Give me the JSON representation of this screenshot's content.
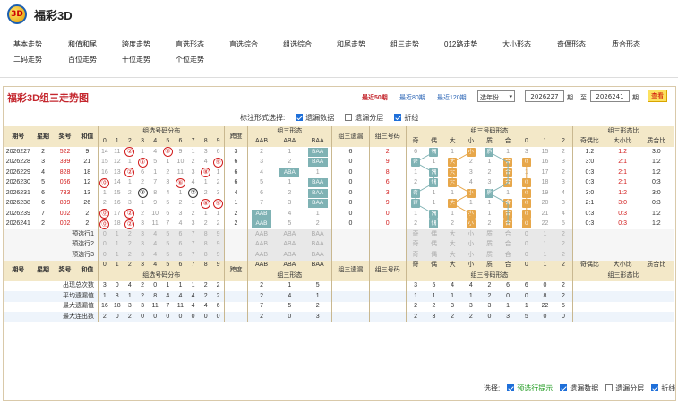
{
  "app": {
    "title": "福彩3D",
    "logo_text": "3D"
  },
  "nav": [
    "基本走势",
    "和值和尾",
    "跨度走势",
    "直选形态",
    "直选综合",
    "组选综合",
    "和尾走势",
    "组三走势",
    "012路走势",
    "大小形态",
    "奇偶形态",
    "质合形态",
    "二码走势",
    "百位走势",
    "十位走势",
    "个位走势"
  ],
  "panel": {
    "title": "福彩3D组三走势图",
    "quick": [
      "最近50期",
      "最近80期",
      "最近120期"
    ],
    "select": "选年份",
    "from": "2026227",
    "sep1": "期",
    "to_label": "至",
    "to": "2026241",
    "sep2": "期",
    "query": "查看"
  },
  "options": {
    "label": "标注形式选择:",
    "items": [
      {
        "text": "遗漏数据",
        "checked": true
      },
      {
        "text": "遗漏分层",
        "checked": false
      },
      {
        "text": "折线",
        "checked": true
      }
    ]
  },
  "headers": {
    "period": "期号",
    "week": "星期",
    "prize": "奖号",
    "sum": "和值",
    "dist": "组选号码分布",
    "span": "跨度",
    "shape": "组三形态",
    "miss": "组三遗漏",
    "code": "组三号码",
    "nshape": "组三号码形态",
    "ratio": "组三形态比",
    "digits": [
      "0",
      "1",
      "2",
      "3",
      "4",
      "5",
      "6",
      "7",
      "8",
      "9"
    ],
    "shapes": [
      "AAB",
      "ABA",
      "BAA"
    ],
    "nshapes": [
      "奇",
      "偶",
      "大",
      "小",
      "质",
      "合",
      "0",
      "1",
      "2"
    ],
    "ratios": [
      "奇偶比",
      "大小比",
      "质合比"
    ]
  },
  "rows": [
    {
      "period": "2026227",
      "week": "2",
      "prize": "522",
      "sum": "9",
      "dist": [
        "14",
        "11",
        "②",
        "1",
        "4",
        "⑤",
        "9",
        "1",
        "3",
        "6"
      ],
      "span": "3",
      "shape": [
        "2",
        "1",
        "BAA"
      ],
      "miss": "6",
      "code": "2",
      "nshape": [
        "6",
        "偶",
        "1",
        "小",
        "质",
        "1",
        "3",
        "15",
        "2"
      ],
      "ratio": [
        "1:2",
        "1:2",
        "3:0"
      ]
    },
    {
      "period": "2026228",
      "week": "3",
      "prize": "399",
      "sum": "21",
      "dist": [
        "15",
        "12",
        "1",
        "⑤",
        "5",
        "1",
        "10",
        "2",
        "4",
        "⑨"
      ],
      "span": "6",
      "shape": [
        "3",
        "2",
        "BAA"
      ],
      "miss": "0",
      "code": "9",
      "nshape": [
        "奇",
        "1",
        "大",
        "2",
        "1",
        "合",
        "0",
        "16",
        "3"
      ],
      "ratio": [
        "3:0",
        "2:1",
        "1:2"
      ]
    },
    {
      "period": "2026229",
      "week": "4",
      "prize": "828",
      "sum": "18",
      "dist": [
        "16",
        "13",
        "②",
        "6",
        "1",
        "2",
        "11",
        "3",
        "⑧",
        "1"
      ],
      "span": "6",
      "shape": [
        "4",
        "ABA",
        "1"
      ],
      "miss": "0",
      "code": "8",
      "nshape": [
        "1",
        "偶",
        "大",
        "3",
        "2",
        "合",
        "1",
        "17",
        "2"
      ],
      "ratio": [
        "0:3",
        "2:1",
        "1:2"
      ]
    },
    {
      "period": "2026230",
      "week": "5",
      "prize": "066",
      "sum": "12",
      "dist": [
        "⓪",
        "14",
        "1",
        "2",
        "7",
        "3",
        "⑥",
        "4",
        "1",
        "2"
      ],
      "span": "6",
      "shape": [
        "5",
        "1",
        "BAA"
      ],
      "miss": "0",
      "code": "6",
      "nshape": [
        "2",
        "偶",
        "大",
        "4",
        "3",
        "合",
        "0",
        "18",
        "3"
      ],
      "ratio": [
        "0:3",
        "2:1",
        "0:3"
      ]
    },
    {
      "period": "2026231",
      "week": "6",
      "prize": "733",
      "sum": "13",
      "dist": [
        "1",
        "15",
        "2",
        "③",
        "8",
        "4",
        "1",
        "⑦",
        "2",
        "3"
      ],
      "span": "4",
      "shape": [
        "6",
        "2",
        "BAA"
      ],
      "miss": "0",
      "code": "3",
      "nshape": [
        "奇",
        "1",
        "1",
        "小",
        "质",
        "1",
        "0",
        "19",
        "4"
      ],
      "ratio": [
        "3:0",
        "1:2",
        "3:0"
      ]
    },
    {
      "period": "2026238",
      "week": "6",
      "prize": "899",
      "sum": "26",
      "dist": [
        "2",
        "16",
        "3",
        "1",
        "9",
        "5",
        "2",
        "1",
        "⑧",
        "⑨"
      ],
      "span": "1",
      "shape": [
        "7",
        "3",
        "BAA"
      ],
      "miss": "0",
      "code": "9",
      "nshape": [
        "奇",
        "1",
        "大",
        "1",
        "1",
        "合",
        "0",
        "20",
        "3"
      ],
      "ratio": [
        "2:1",
        "3:0",
        "0:3"
      ]
    },
    {
      "period": "2026239",
      "week": "7",
      "prize": "002",
      "sum": "2",
      "dist": [
        "⓪",
        "17",
        "②",
        "2",
        "10",
        "6",
        "3",
        "2",
        "1",
        "1"
      ],
      "span": "2",
      "shape": [
        "AAB",
        "4",
        "1"
      ],
      "miss": "0",
      "code": "0",
      "nshape": [
        "1",
        "偶",
        "1",
        "小",
        "1",
        "合",
        "0",
        "21",
        "4"
      ],
      "ratio": [
        "0:3",
        "0:3",
        "1:2"
      ]
    },
    {
      "period": "2026241",
      "week": "2",
      "prize": "002",
      "sum": "2",
      "dist": [
        "⓪",
        "18",
        "②",
        "3",
        "11",
        "7",
        "4",
        "3",
        "2",
        "2"
      ],
      "span": "2",
      "shape": [
        "AAB",
        "5",
        "2"
      ],
      "miss": "0",
      "code": "0",
      "nshape": [
        "2",
        "偶",
        "2",
        "小",
        "2",
        "合",
        "0",
        "22",
        "5"
      ],
      "ratio": [
        "0:3",
        "0:3",
        "1:2"
      ]
    }
  ],
  "predict": {
    "rows": [
      "预选行1",
      "预选行2",
      "预选行3"
    ]
  },
  "stats": {
    "row_labels": [
      "出现总次数",
      "平均遗漏值",
      "最大遗漏值",
      "最大连出数"
    ],
    "dist": [
      [
        "3",
        "0",
        "4",
        "2",
        "0",
        "1",
        "1",
        "1",
        "2",
        "2"
      ],
      [
        "1",
        "8",
        "1",
        "2",
        "8",
        "4",
        "4",
        "4",
        "2",
        "2"
      ],
      [
        "16",
        "18",
        "3",
        "3",
        "11",
        "7",
        "11",
        "4",
        "4",
        "6"
      ],
      [
        "2",
        "0",
        "2",
        "0",
        "0",
        "0",
        "0",
        "0",
        "0",
        "0"
      ]
    ],
    "shape": [
      [
        "2",
        "1",
        "5"
      ],
      [
        "2",
        "4",
        "1"
      ],
      [
        "7",
        "5",
        "2"
      ],
      [
        "2",
        "0",
        "3"
      ]
    ],
    "nshape": [
      [
        "3",
        "5",
        "4",
        "4",
        "2",
        "6",
        "6",
        "0",
        "2"
      ],
      [
        "1",
        "1",
        "1",
        "1",
        "2",
        "0",
        "0",
        "8",
        "2"
      ],
      [
        "2",
        "2",
        "3",
        "3",
        "3",
        "1",
        "1",
        "22",
        "5"
      ],
      [
        "2",
        "3",
        "2",
        "2",
        "0",
        "3",
        "5",
        "0",
        "0"
      ]
    ]
  },
  "bottom": {
    "label": "选择:",
    "items": [
      {
        "text": "预选行提示",
        "checked": true,
        "green": true
      },
      {
        "text": "遗漏数据",
        "checked": true
      },
      {
        "text": "遗漏分层",
        "checked": false
      },
      {
        "text": "折线",
        "checked": true
      }
    ]
  },
  "colors": {
    "accent": "#c4262d",
    "header_bg": "#f3e8c8",
    "tag": "#7fb2b4",
    "line_orange": "#e7a74a"
  }
}
